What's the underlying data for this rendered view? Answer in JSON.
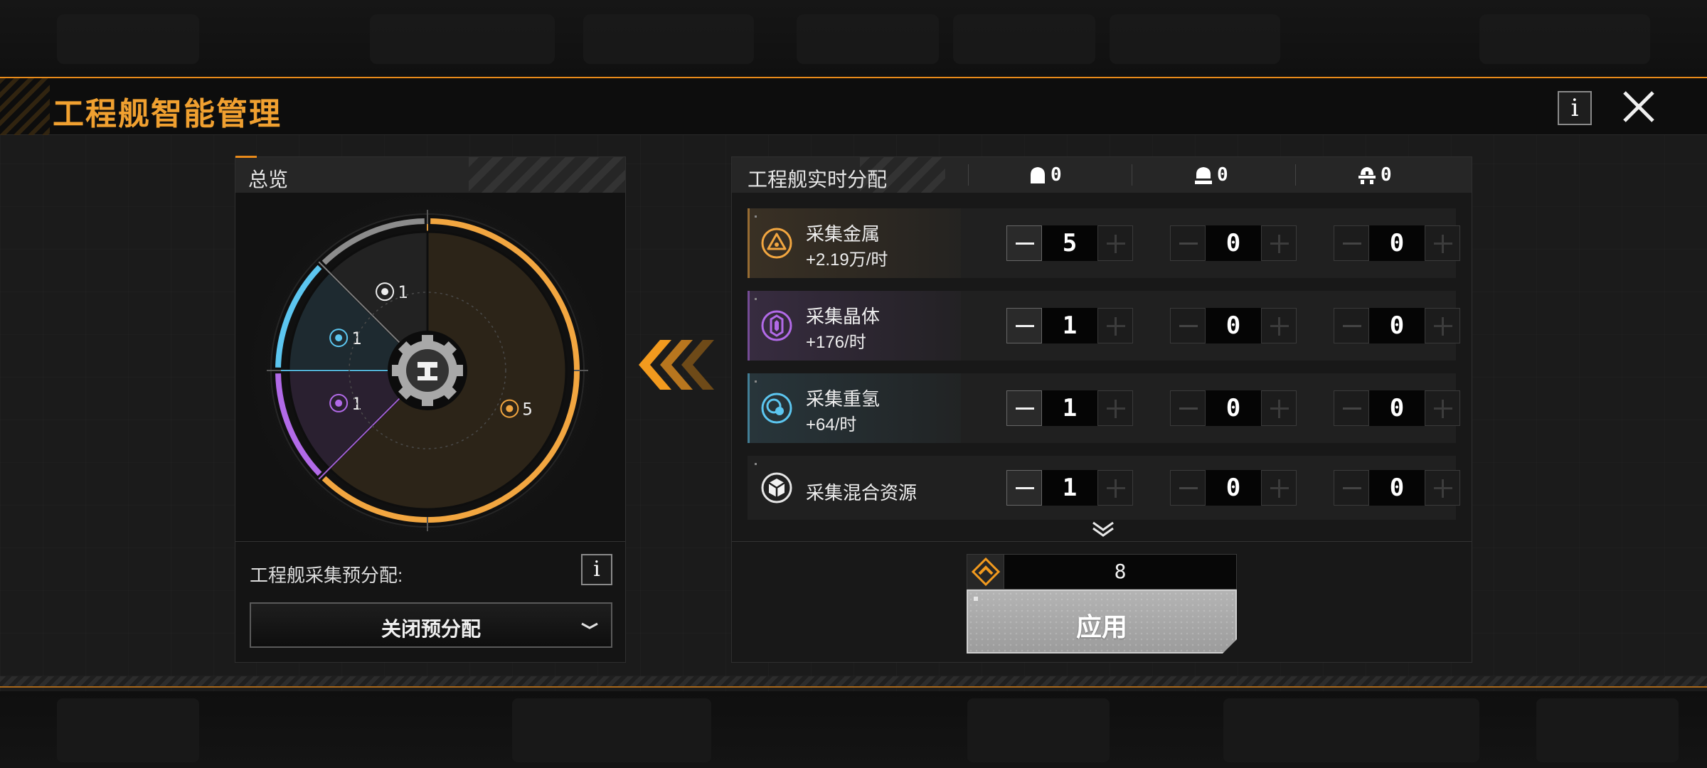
{
  "modal": {
    "title": "工程舰智能管理",
    "info_label": "i"
  },
  "overview": {
    "title": "总览",
    "center_icon": "engineering-ship-gear-icon",
    "segments": [
      {
        "key": "metal",
        "icon": "metal-triangle-icon",
        "count": "5",
        "value": 5,
        "color": "#f2a640"
      },
      {
        "key": "crystal",
        "icon": "crystal-hexagon-icon",
        "count": "1",
        "value": 1,
        "color": "#b26ae8"
      },
      {
        "key": "deuterium",
        "icon": "deuterium-orb-icon",
        "count": "1",
        "value": 1,
        "color": "#5cc6f0"
      },
      {
        "key": "mixed",
        "icon": "mixed-cube-icon",
        "count": "1",
        "value": 1,
        "color": "#8c8c8c"
      }
    ],
    "preallocation_label": "工程舰采集预分配:",
    "preallocation_info": "i",
    "preallocation_value": "关闭预分配"
  },
  "allocation": {
    "title": "工程舰实时分配",
    "columns": [
      {
        "icon": "ship-type-1-icon",
        "count": "0"
      },
      {
        "icon": "ship-type-2-icon",
        "count": "0"
      },
      {
        "icon": "ship-type-3-icon",
        "count": "0"
      }
    ],
    "rows": [
      {
        "name": "采集金属",
        "rate": "+2.19万/时",
        "icon": "metal-triangle-icon",
        "color": "#f2a640",
        "values": [
          "5",
          "0",
          "0"
        ]
      },
      {
        "name": "采集晶体",
        "rate": "+176/时",
        "icon": "crystal-hexagon-icon",
        "color": "#b26ae8",
        "values": [
          "1",
          "0",
          "0"
        ]
      },
      {
        "name": "采集重氢",
        "rate": "+64/时",
        "icon": "deuterium-orb-icon",
        "color": "#5cc6f0",
        "values": [
          "1",
          "0",
          "0"
        ]
      },
      {
        "name": "采集混合资源",
        "rate": "",
        "icon": "mixed-cube-icon",
        "color": "#e0e0e0",
        "values": [
          "1",
          "0",
          "0"
        ]
      }
    ],
    "cost_icon": "engineering-ship-rank-icon",
    "cost_value": "8",
    "apply_label": "应用"
  },
  "colors": {
    "accent": "#e88a1a",
    "title": "#f0a030"
  }
}
